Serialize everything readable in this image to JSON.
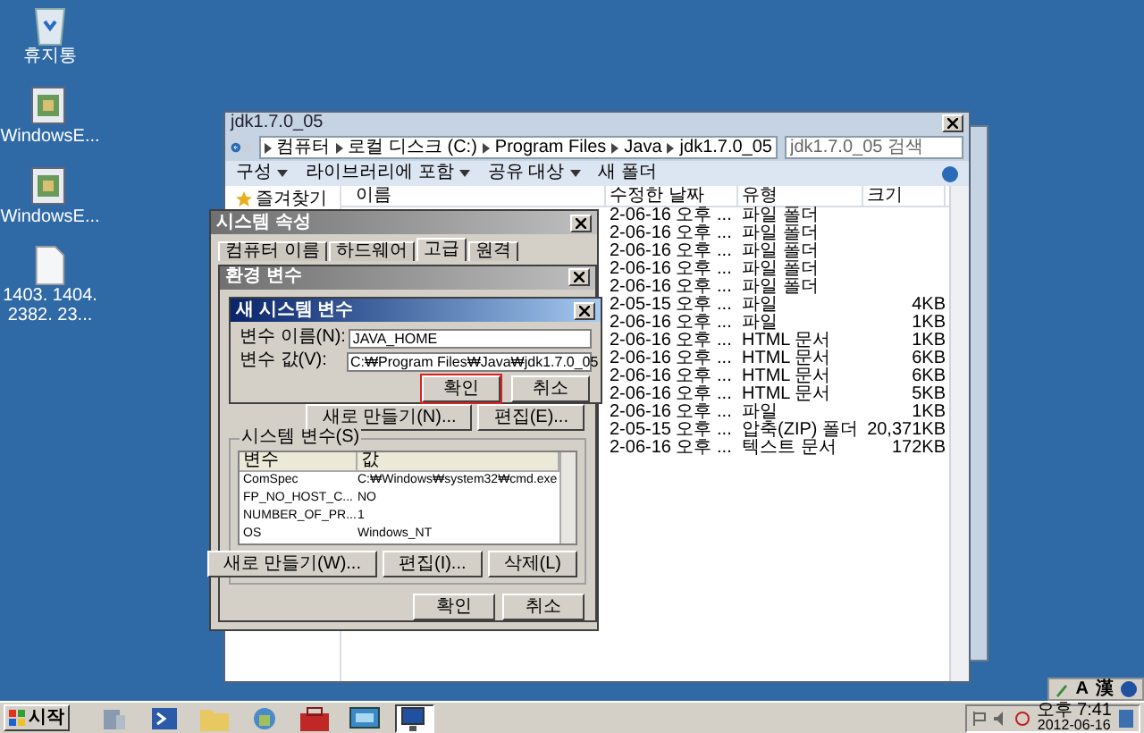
{
  "desktop_icons": [
    {
      "kind": "recycle",
      "label": "휴지통"
    },
    {
      "kind": "app",
      "label": "WindowsE..."
    },
    {
      "kind": "app",
      "label": "WindowsE..."
    },
    {
      "kind": "file",
      "label": "1403. 1404. 2382. 23..."
    }
  ],
  "explorer": {
    "title": "jdk1.7.0_05",
    "breadcrumb": [
      "컴퓨터",
      "로컬 디스크 (C:)",
      "Program Files",
      "Java",
      "jdk1.7.0_05"
    ],
    "search": {
      "placeholder": "jdk1.7.0_05 검색"
    },
    "toolbar": [
      {
        "label": "구성",
        "dropdown": true
      },
      {
        "label": "라이브러리에 포함",
        "dropdown": true
      },
      {
        "label": "공유 대상",
        "dropdown": true
      },
      {
        "label": "새 폴더",
        "dropdown": false
      }
    ],
    "nav": [
      "즐겨찾기"
    ],
    "columns": [
      "이름",
      "수정한 날짜",
      "유형",
      "크기"
    ],
    "rows": [
      {
        "date": "2-06-16 오후 ...",
        "type": "파일 폴더"
      },
      {
        "date": "2-06-16 오후 ...",
        "type": "파일 폴더"
      },
      {
        "date": "2-06-16 오후 ...",
        "type": "파일 폴더"
      },
      {
        "date": "2-06-16 오후 ...",
        "type": "파일 폴더"
      },
      {
        "date": "2-06-16 오후 ...",
        "type": "파일 폴더"
      },
      {
        "date": "2-05-15 오후 ...",
        "type": "파일",
        "size": "4KB"
      },
      {
        "date": "2-06-16 오후 ...",
        "type": "파일",
        "size": "1KB"
      },
      {
        "date": "2-06-16 오후 ...",
        "type": "HTML 문서",
        "size": "1KB"
      },
      {
        "date": "2-06-16 오후 ...",
        "type": "HTML 문서",
        "size": "6KB"
      },
      {
        "date": "2-06-16 오후 ...",
        "type": "HTML 문서",
        "size": "6KB"
      },
      {
        "date": "2-06-16 오후 ...",
        "type": "HTML 문서",
        "size": "5KB"
      },
      {
        "date": "2-06-16 오후 ...",
        "type": "파일",
        "size": "1KB"
      },
      {
        "date": "2-05-15 오후 ...",
        "type": "압축(ZIP) 폴더",
        "size": "20,371KB"
      },
      {
        "date": "2-06-16 오후 ...",
        "type": "텍스트 문서",
        "size": "172KB"
      }
    ]
  },
  "system_properties": {
    "title": "시스템 속성",
    "tabs": [
      {
        "label": "컴퓨터 이름",
        "selected": false
      },
      {
        "label": "하드웨어",
        "selected": false
      },
      {
        "label": "고급",
        "selected": true
      },
      {
        "label": "원격",
        "selected": false
      }
    ]
  },
  "environment_variables": {
    "title": "환경 변수",
    "user_buttons": [
      "새로 만들기(N)...",
      "편집(E)..."
    ],
    "system_section": "시스템 변수(S)",
    "system_columns": [
      "변수",
      "값"
    ],
    "system_rows": [
      {
        "name": "ComSpec",
        "value": "C:₩Windows₩system32₩cmd.exe"
      },
      {
        "name": "FP_NO_HOST_C...",
        "value": "NO"
      },
      {
        "name": "NUMBER_OF_PR...",
        "value": "1"
      },
      {
        "name": "OS",
        "value": "Windows_NT"
      }
    ],
    "system_buttons": [
      "새로 만들기(W)...",
      "편집(I)...",
      "삭제(L)"
    ],
    "buttons": [
      "확인",
      "취소"
    ]
  },
  "new_variable": {
    "title": "새 시스템 변수",
    "fields": [
      {
        "label": "변수 이름(N):",
        "value": "JAVA_HOME"
      },
      {
        "label": "변수 값(V):",
        "value": "C:₩Program Files₩Java₩jdk1.7.0_05"
      }
    ],
    "buttons": [
      {
        "label": "확인",
        "highlighted": true
      },
      {
        "label": "취소",
        "highlighted": false
      }
    ]
  },
  "language_bar": [
    "A",
    "漢"
  ],
  "taskbar": {
    "start": "시작",
    "apps": [
      {
        "kind": "server",
        "selected": false
      },
      {
        "kind": "shell",
        "selected": false
      },
      {
        "kind": "folder",
        "selected": false
      },
      {
        "kind": "network",
        "selected": false
      },
      {
        "kind": "toolbox",
        "selected": false
      },
      {
        "kind": "monitor",
        "selected": false
      },
      {
        "kind": "system",
        "selected": true
      }
    ],
    "clock": {
      "time": "오후 7:41",
      "date": "2012-06-16"
    }
  }
}
